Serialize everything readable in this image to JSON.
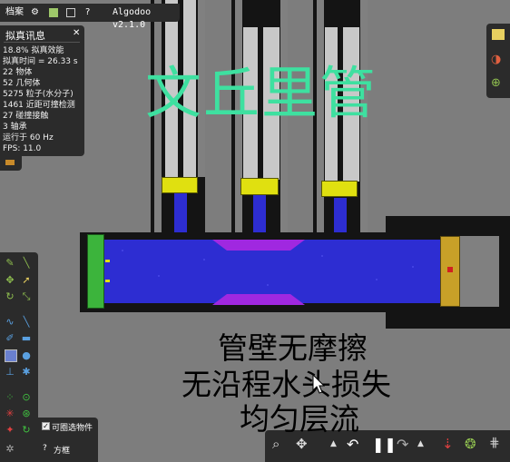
{
  "menubar": {
    "file_label": "档案",
    "title": "Algodoo v2.1.0",
    "help_label": "?"
  },
  "stats_panel": {
    "title": "拟真讯息",
    "lines": [
      "18.8% 拟真效能",
      "拟真时间 = 26.33 s",
      "22 物体",
      "52 几何体",
      "5275 粒子(水分子)",
      "1461 近距可撞检测",
      "27 碰撞接触",
      "3 轴承",
      "运行于 60 Hz",
      "FPS: 11.0"
    ]
  },
  "overlay": {
    "title": "文丘里管",
    "notes": [
      "管壁无摩擦",
      "无沿程水头损失",
      "均匀层流"
    ]
  },
  "bottom_panel": {
    "select_label": "可圈选物件",
    "select_checked": true,
    "grid_label": "方框",
    "grid_prefix": "?"
  },
  "colors": {
    "water": "#2d2dd2",
    "gauge_cap": "#e0e010",
    "constriction": "#a028e0",
    "piston_left": "#3cb43c",
    "piston_right": "#c8a028",
    "title_green": "#3ee0a0"
  }
}
